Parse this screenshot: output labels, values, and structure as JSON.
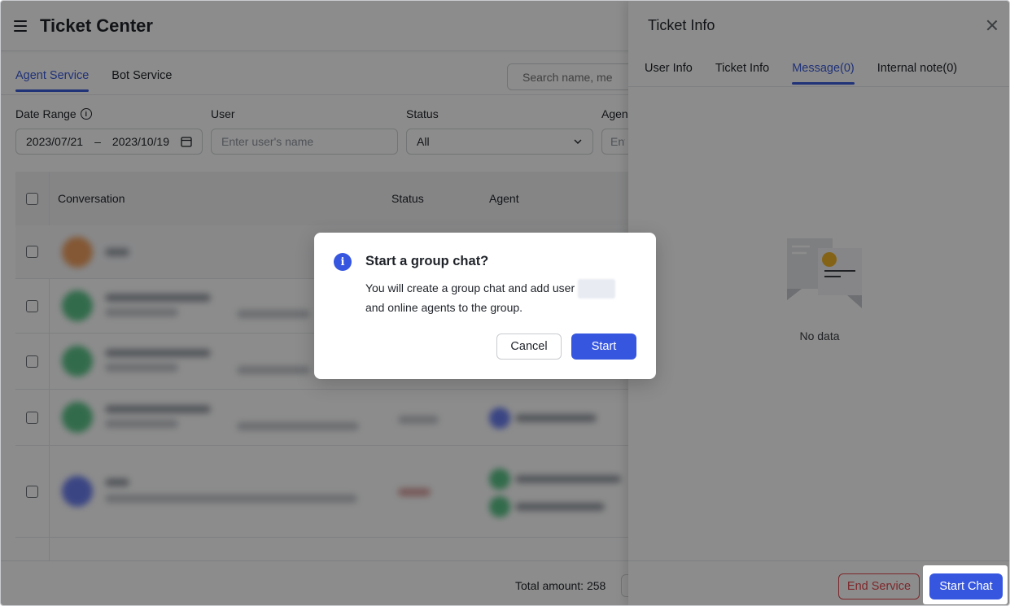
{
  "page": {
    "title": "Ticket Center",
    "tabs": [
      {
        "label": "Agent Service",
        "active": true
      },
      {
        "label": "Bot Service",
        "active": false
      }
    ],
    "search_placeholder": "Search name, me"
  },
  "filters": {
    "date_range_label": "Date Range",
    "date_start": "2023/07/21",
    "date_sep": "–",
    "date_end": "2023/10/19",
    "user_label": "User",
    "user_placeholder": "Enter user's name",
    "status_label": "Status",
    "status_value": "All",
    "agent_label": "Agen",
    "agent_placeholder": "Ent"
  },
  "table": {
    "headers": {
      "conversation": "Conversation",
      "status": "Status",
      "agent": "Agent"
    },
    "rows": [
      {
        "avatar_color": "#f0a060"
      },
      {
        "avatar_color": "#5cc48a"
      },
      {
        "avatar_color": "#5cc48a"
      },
      {
        "avatar_color": "#5cc48a"
      },
      {
        "avatar_color": "#6b7ff0"
      }
    ]
  },
  "footer": {
    "total_label": "Total amount: 258"
  },
  "drawer": {
    "title": "Ticket Info",
    "tabs": [
      {
        "label": "User Info",
        "active": false
      },
      {
        "label": "Ticket Info",
        "active": false
      },
      {
        "label": "Message(0)",
        "active": true
      },
      {
        "label": "Internal note(0)",
        "active": false
      }
    ],
    "empty_text": "No data",
    "end_service_label": "End Service",
    "start_chat_label": "Start Chat"
  },
  "modal": {
    "title": "Start a group chat?",
    "body_line1": "You will create a group chat and add user",
    "body_line2": "and online agents to the group.",
    "cancel_label": "Cancel",
    "start_label": "Start"
  },
  "colors": {
    "accent": "#3656e0",
    "danger": "#e5484d",
    "overlay": "rgba(0,0,0,0.45)"
  }
}
